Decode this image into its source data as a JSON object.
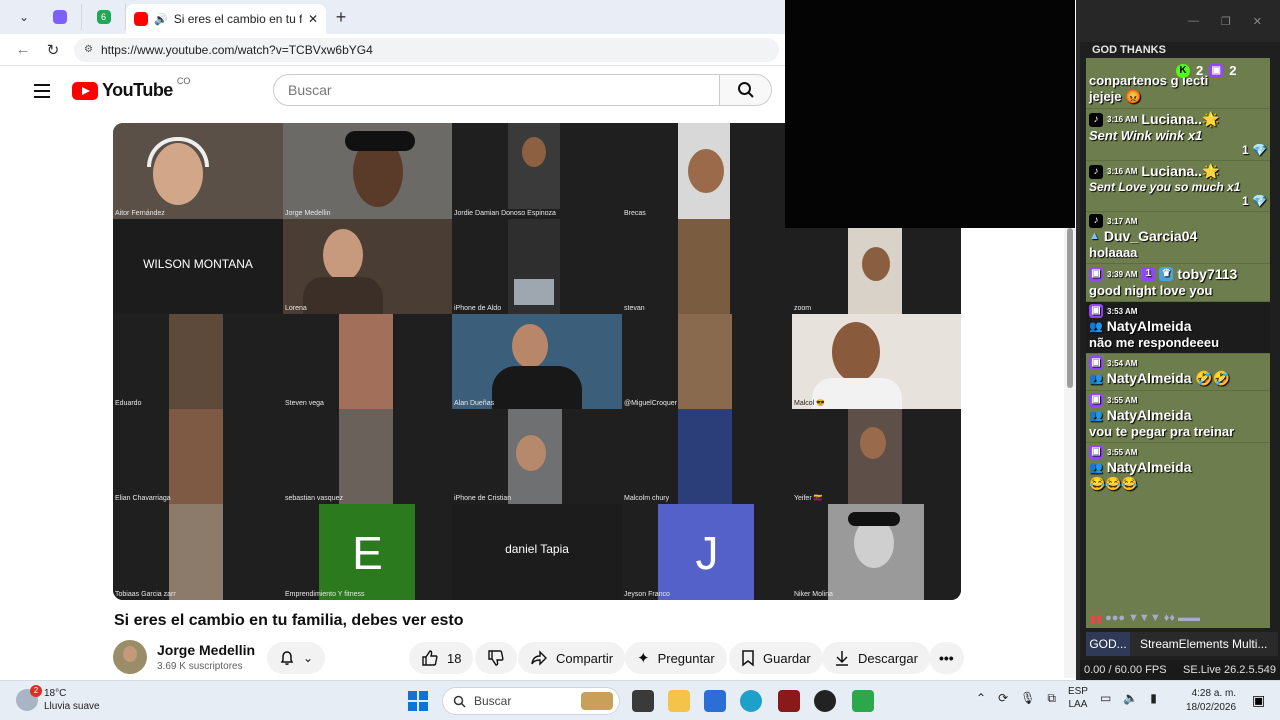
{
  "browser": {
    "tab_small_badge": "6",
    "active_tab_title": "Si eres el cambio en tu familia",
    "url": "https://www.youtube.com/watch?v=TCBVxw6bYG4"
  },
  "youtube": {
    "logo": "YouTube",
    "country": "CO",
    "search_placeholder": "Buscar",
    "video_title": "Si eres el cambio en tu familia, debes ver esto",
    "channel_name": "Jorge Medellin",
    "subscribers": "3.69 K suscriptores",
    "likes": "18",
    "share_label": "Compartir",
    "ask_label": "Preguntar",
    "save_label": "Guardar",
    "download_label": "Descargar"
  },
  "video": {
    "participants": [
      "Aitor Fernández",
      "Jorge Medellin",
      "Jordie Damian Donoso Espinoza",
      "Brecas",
      "WILSON MONTANA",
      "Lorena",
      "iPhone de Aldo",
      "stevan",
      "zoom",
      "Eduardo",
      "Steven vega",
      "Alan Dueñas",
      "@MiguelCroquer",
      "Malcol 😎",
      "Elian Chavarriaga",
      "sebastian vasquez",
      "iPhone de Cristian",
      "Malcolm chury",
      "Yeifer 🇻🇪",
      "Tobiaas Garcia zarr",
      "Emprendimiento Y fitness",
      "daniel Tapia",
      "Jeyson Franco",
      "Niker Molina"
    ],
    "letters": [
      "E",
      "J"
    ]
  },
  "stream_panel": {
    "header": "GOD THANKS",
    "badge_count_1": "2",
    "badge_count_2": "2",
    "messages": [
      {
        "text": "conpartenos g    lecti",
        "text2": "jejeje 😡"
      },
      {
        "time": "3:16 AM",
        "user": "Luciana..🌟",
        "gift": "Sent Wink wink x1",
        "count": "1 💎"
      },
      {
        "time": "3:16 AM",
        "user": "Luciana..🌟",
        "gift": "Sent Love you so much x1",
        "count": "1 💎"
      },
      {
        "time": "3:17 AM",
        "user": "Duv_Garcia04",
        "text": "holaaaa"
      },
      {
        "time": "3:39 AM",
        "user": "toby7113",
        "text": "good night love you"
      },
      {
        "time": "3:53 AM",
        "user": "NatyAlmeida",
        "text": "não me respondeeeu"
      },
      {
        "time": "3:54 AM",
        "user": "NatyAlmeida 🤣🤣",
        "text": ""
      },
      {
        "time": "3:55 AM",
        "user": "NatyAlmeida",
        "text": "vou te pegar pra treinar"
      },
      {
        "time": "3:55 AM",
        "user": "NatyAlmeida",
        "text": "😂😂😂"
      }
    ],
    "tab1": "GOD...",
    "tab2": "StreamElements Multi...",
    "fps": "0.00 / 60.00 FPS",
    "version": "SE.Live 26.2.5.549"
  },
  "taskbar": {
    "weather_badge": "2",
    "temperature": "18°C",
    "weather": "Lluvia suave",
    "search": "Buscar",
    "lang1": "ESP",
    "lang2": "LAA",
    "time": "4:28 a. m.",
    "date": "18/02/2026"
  }
}
